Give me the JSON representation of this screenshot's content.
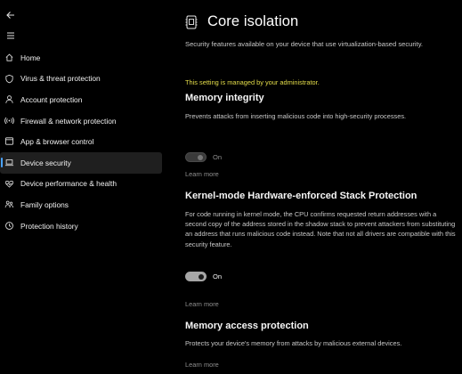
{
  "sidebar": {
    "items": [
      {
        "label": "Home",
        "icon": "home-icon"
      },
      {
        "label": "Virus & threat protection",
        "icon": "shield-icon"
      },
      {
        "label": "Account protection",
        "icon": "person-icon"
      },
      {
        "label": "Firewall & network protection",
        "icon": "wifi-icon"
      },
      {
        "label": "App & browser control",
        "icon": "browser-icon"
      },
      {
        "label": "Device security",
        "icon": "laptop-icon",
        "selected": true
      },
      {
        "label": "Device performance & health",
        "icon": "heart-icon"
      },
      {
        "label": "Family options",
        "icon": "family-icon"
      },
      {
        "label": "Protection history",
        "icon": "history-icon"
      }
    ]
  },
  "page": {
    "title": "Core isolation",
    "description": "Security features available on your device that use virtualization-based security.",
    "admin_note": "This setting is managed by your administrator."
  },
  "sections": {
    "memory_integrity": {
      "title": "Memory integrity",
      "description": "Prevents attacks from inserting malicious code into high-security processes.",
      "toggle_state": "On",
      "toggle_enabled": false,
      "learn_more": "Learn more"
    },
    "kernel_stack": {
      "title": "Kernel-mode Hardware-enforced Stack Protection",
      "description": "For code running in kernel mode, the CPU confirms requested return addresses with a second copy of the address stored in the shadow stack to prevent attackers from substituting an address that runs malicious code instead. Note that not all drivers are compatible with this security feature.",
      "toggle_state": "On",
      "toggle_enabled": true,
      "learn_more": "Learn more"
    },
    "memory_access": {
      "title": "Memory access protection",
      "description": "Protects your device's memory from attacks by malicious external devices.",
      "learn_more": "Learn more"
    }
  },
  "colors": {
    "background": "#000000",
    "accent": "#4aa3ff",
    "admin_note": "#e5de4a",
    "selected_item_bg": "#1f1f1f"
  }
}
